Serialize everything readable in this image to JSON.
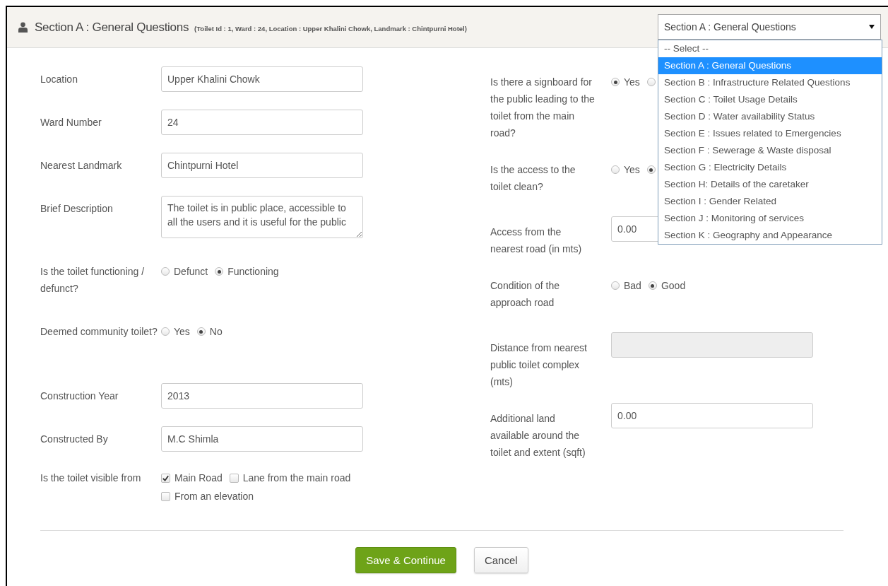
{
  "header": {
    "title": "Section A : General Questions",
    "details": "(Toilet Id : 1,  Ward : 24, Location : Upper Khalini Chowk, Landmark : Chintpurni Hotel)"
  },
  "section_select": {
    "value": "Section A : General Questions",
    "expanded": true,
    "options": [
      {
        "label": "-- Select --",
        "selected": false
      },
      {
        "label": "Section A : General Questions",
        "selected": true
      },
      {
        "label": "Section B : Infrastructure Related Questions",
        "selected": false
      },
      {
        "label": "Section C : Toilet Usage Details",
        "selected": false
      },
      {
        "label": "Section D : Water availability Status",
        "selected": false
      },
      {
        "label": "Section E : Issues related to Emergencies",
        "selected": false
      },
      {
        "label": "Section F : Sewerage & Waste disposal",
        "selected": false
      },
      {
        "label": "Section G : Electricity Details",
        "selected": false
      },
      {
        "label": "Section H: Details of the caretaker",
        "selected": false
      },
      {
        "label": "Section I : Gender Related",
        "selected": false
      },
      {
        "label": "Section J : Monitoring of services",
        "selected": false
      },
      {
        "label": "Section K : Geography and Appearance",
        "selected": false
      }
    ]
  },
  "left_fields": [
    {
      "label": "Location",
      "kind": "text",
      "value": "Upper Khalini Chowk",
      "disabled": false
    },
    {
      "label": "Ward Number",
      "kind": "text",
      "value": "24",
      "disabled": false
    },
    {
      "label": "Nearest Landmark",
      "kind": "text",
      "value": "Chintpurni Hotel",
      "disabled": false
    },
    {
      "label": "Brief Description",
      "kind": "textarea",
      "value": "The toilet is in public place, accessible to all the users and it is useful for the public"
    },
    {
      "label": "Is the toilet functioning / defunct?",
      "kind": "radio",
      "options": [
        {
          "label": "Defunct",
          "selected": false
        },
        {
          "label": "Functioning",
          "selected": true
        }
      ]
    },
    {
      "label": "Deemed community toilet?",
      "kind": "radio",
      "options": [
        {
          "label": "Yes",
          "selected": false
        },
        {
          "label": "No",
          "selected": true
        }
      ]
    },
    {
      "label": "Construction Year",
      "kind": "text",
      "value": "2013",
      "disabled": false
    },
    {
      "label": "Constructed By",
      "kind": "text",
      "value": "M.C Shimla",
      "disabled": false
    },
    {
      "label": "Is the toilet visible from",
      "kind": "checkbox",
      "options": [
        {
          "label": "Main Road",
          "checked": true
        },
        {
          "label": "Lane from the main road",
          "checked": false
        },
        {
          "label": "From an elevation",
          "checked": false
        }
      ]
    }
  ],
  "right_fields": [
    {
      "label": "Is there a signboard for the public leading to the toilet from the main road?",
      "kind": "radio",
      "options": [
        {
          "label": "Yes",
          "selected": true
        },
        {
          "selected": false
        }
      ]
    },
    {
      "label": "Is the access to the toilet clean?",
      "kind": "radio",
      "options": [
        {
          "label": "Yes",
          "selected": false
        },
        {
          "selected": true
        }
      ]
    },
    {
      "label": "Access from the nearest road (in mts)",
      "kind": "text",
      "value": "0.00",
      "disabled": false
    },
    {
      "label": "Condition of the approach road",
      "kind": "radio",
      "options": [
        {
          "label": "Bad",
          "selected": false
        },
        {
          "label": "Good",
          "selected": true
        }
      ]
    },
    {
      "label": "Distance from nearest public toilet complex (mts)",
      "kind": "text",
      "disabled": true
    },
    {
      "label": "Additional land available around the toilet and extent (sqft)",
      "kind": "text",
      "value": "0.00",
      "disabled": false
    }
  ],
  "buttons": [
    {
      "label": "Save & Continue",
      "kind": "primary"
    },
    {
      "label": "Cancel",
      "kind": "default"
    }
  ]
}
